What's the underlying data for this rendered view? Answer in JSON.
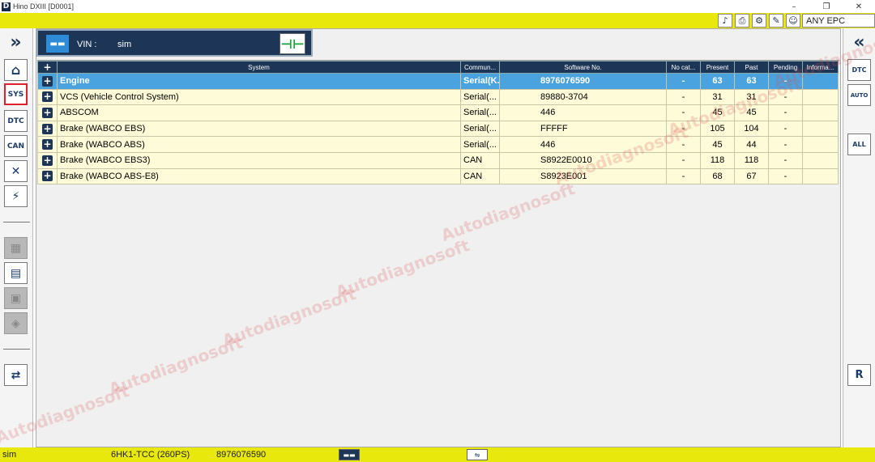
{
  "window": {
    "title": "Hino DXIII  [D0001]",
    "logo": "D",
    "controls": [
      "–",
      "❐",
      "✕"
    ]
  },
  "toolbar": {
    "icons": [
      "sound-icon",
      "print-icon",
      "gear-icon",
      "edit-icon",
      "user-icon"
    ],
    "epc_label": "ANY EPC"
  },
  "left_sidebar": {
    "items": [
      {
        "name": "expand-chevrons-icon",
        "label": "»"
      },
      {
        "name": "home-icon",
        "label": "⌂"
      },
      {
        "name": "sys-icon",
        "label": "SYS"
      },
      {
        "name": "dtc-icon",
        "label": "DTC"
      },
      {
        "name": "can-icon",
        "label": "CAN"
      },
      {
        "name": "tools-icon",
        "label": "✕"
      },
      {
        "name": "flash-icon",
        "label": "⚡"
      },
      {
        "name": "module-disabled-icon",
        "label": "▦"
      },
      {
        "name": "worksheet-icon",
        "label": "▤"
      },
      {
        "name": "lock-disabled-icon",
        "label": "▣"
      },
      {
        "name": "settings-disabled-icon",
        "label": "◈"
      },
      {
        "name": "ecu-replace-icon",
        "label": "⇄"
      }
    ]
  },
  "right_sidebar": {
    "items": [
      {
        "name": "collapse-chevrons-icon",
        "label": "«"
      },
      {
        "name": "dtc-clear-icon",
        "label": "DTC"
      },
      {
        "name": "auto-dtc-icon",
        "label": "AUTO"
      },
      {
        "name": "all-dtc-icon",
        "label": "ALL"
      },
      {
        "name": "replay-icon",
        "label": "R"
      }
    ]
  },
  "vin_panel": {
    "vin_label": "VIN :",
    "vin_value": "sim",
    "truck_glyph": "▬▬"
  },
  "table": {
    "headers": [
      "+",
      "System",
      "Commun...",
      "Software No.",
      "No cat...",
      "Present",
      "Past",
      "Pending",
      "Informa..."
    ],
    "rows": [
      {
        "system": "Engine",
        "comm": "Serial(K...",
        "software": "8976076590",
        "nocat": "-",
        "present": "63",
        "past": "63",
        "pending": "-",
        "info": "",
        "selected": true
      },
      {
        "system": "VCS (Vehicle Control System)",
        "comm": "Serial(...",
        "software": "89880-3704",
        "nocat": "-",
        "present": "31",
        "past": "31",
        "pending": "-",
        "info": ""
      },
      {
        "system": "ABSCOM",
        "comm": "Serial(...",
        "software": "446",
        "nocat": "-",
        "present": "45",
        "past": "45",
        "pending": "-",
        "info": ""
      },
      {
        "system": "Brake (WABCO EBS)",
        "comm": "Serial(...",
        "software": "FFFFF",
        "nocat": "-",
        "present": "105",
        "past": "104",
        "pending": "-",
        "info": ""
      },
      {
        "system": "Brake (WABCO ABS)",
        "comm": "Serial(...",
        "software": "446",
        "nocat": "-",
        "present": "45",
        "past": "44",
        "pending": "-",
        "info": ""
      },
      {
        "system": "Brake (WABCO EBS3)",
        "comm": "CAN",
        "software": "S8922E0010",
        "nocat": "-",
        "present": "118",
        "past": "118",
        "pending": "-",
        "info": ""
      },
      {
        "system": "Brake (WABCO ABS-E8)",
        "comm": "CAN",
        "software": "S8923E001",
        "nocat": "-",
        "present": "68",
        "past": "67",
        "pending": "-",
        "info": ""
      }
    ]
  },
  "statusbar": {
    "mode": "sim",
    "engine": "6HK1-TCC (260PS)",
    "software": "8976076590"
  },
  "watermark": "Autodiagnosoft"
}
